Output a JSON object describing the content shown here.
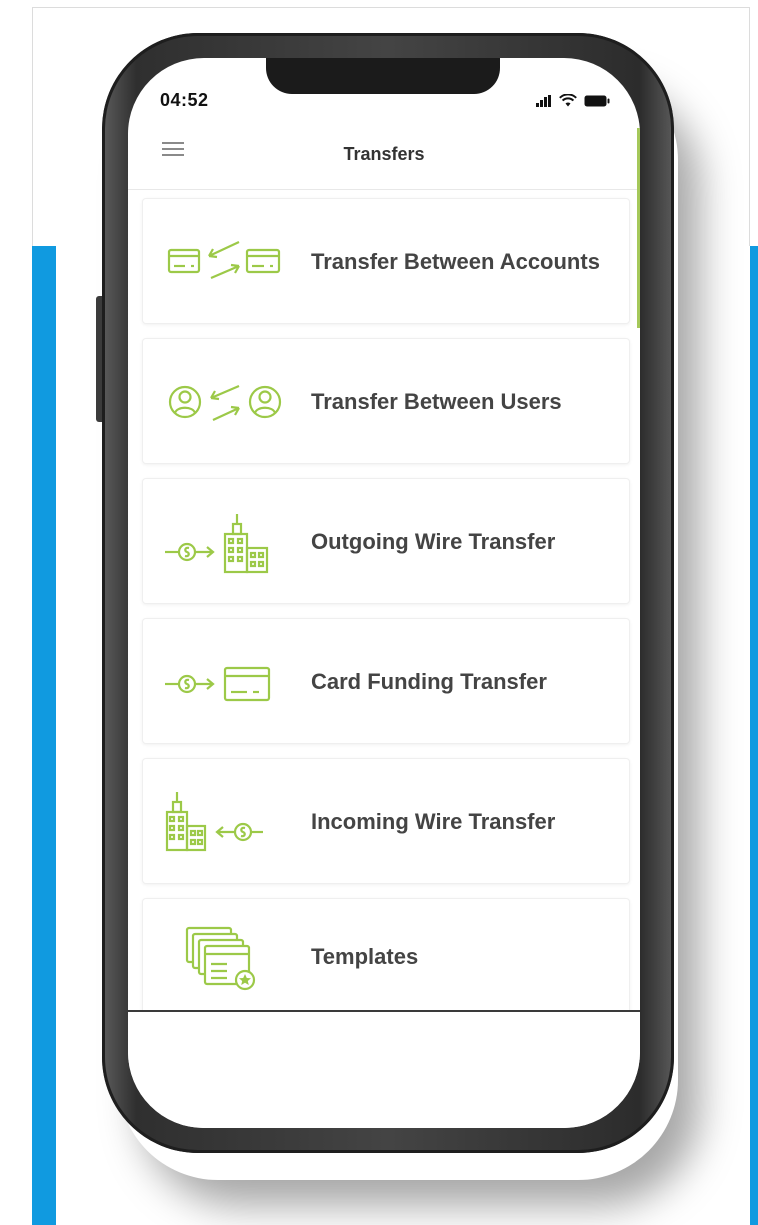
{
  "status_bar": {
    "time": "04:52"
  },
  "header": {
    "title": "Transfers"
  },
  "transfers": [
    {
      "label": "Transfer Between Accounts",
      "icon": "card-exchange-icon"
    },
    {
      "label": "Transfer Between Users",
      "icon": "user-exchange-icon"
    },
    {
      "label": "Outgoing Wire Transfer",
      "icon": "outgoing-wire-icon"
    },
    {
      "label": "Card Funding Transfer",
      "icon": "card-funding-icon"
    },
    {
      "label": "Incoming Wire Transfer",
      "icon": "incoming-wire-icon"
    },
    {
      "label": "Templates",
      "icon": "templates-icon"
    }
  ],
  "colors": {
    "accent_green": "#9cc948",
    "background_blue": "#109ae0"
  }
}
